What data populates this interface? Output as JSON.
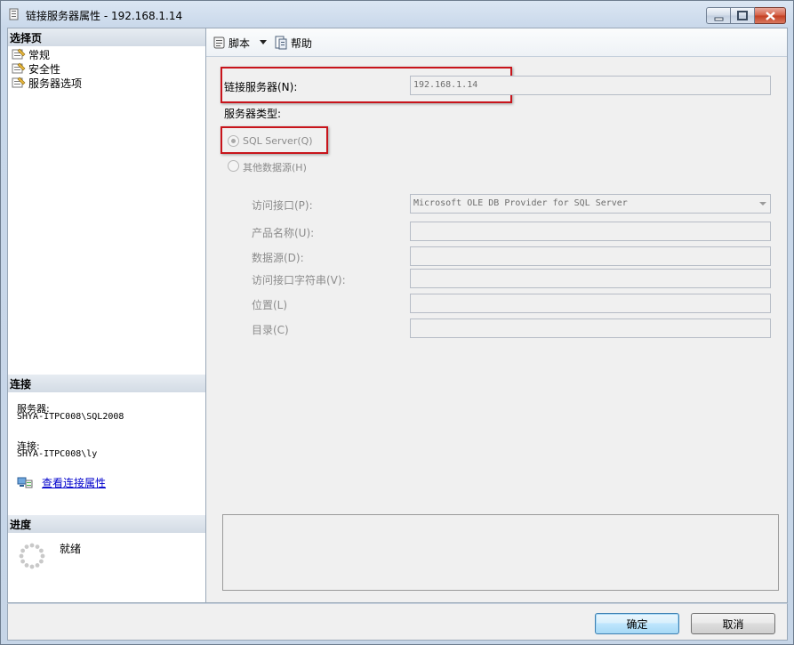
{
  "window": {
    "title": "链接服务器属性 - 192.168.1.14"
  },
  "left_pane": {
    "select_page_header": "选择页",
    "pages": [
      {
        "label": "常规"
      },
      {
        "label": "安全性"
      },
      {
        "label": "服务器选项"
      }
    ],
    "connection_header": "连接",
    "server_label": "服务器:",
    "server_value": "SHYA-ITPC008\\SQL2008",
    "connection_label": "连接:",
    "connection_value": "SHYA-ITPC008\\ly",
    "view_connection_link": "查看连接属性",
    "progress_header": "进度",
    "progress_status": "就绪"
  },
  "toolbar": {
    "script_label": "脚本",
    "help_label": "帮助"
  },
  "form": {
    "linked_server_label": "链接服务器(N):",
    "linked_server_value": "192.168.1.14",
    "server_type_label": "服务器类型:",
    "radio_sql_server": "SQL Server(Q)",
    "radio_other": "其他数据源(H)",
    "provider_label": "访问接口(P):",
    "provider_value": "Microsoft OLE DB Provider for SQL Server",
    "product_name_label": "产品名称(U):",
    "product_name_value": "",
    "data_source_label": "数据源(D):",
    "data_source_value": "",
    "provider_string_label": "访问接口字符串(V):",
    "provider_string_value": "",
    "location_label": "位置(L)",
    "location_value": "",
    "catalog_label": "目录(C)",
    "catalog_value": ""
  },
  "footer": {
    "ok_label": "确定",
    "cancel_label": "取消"
  },
  "colors": {
    "highlight_box": "#c8141b",
    "link": "#0000cc"
  }
}
